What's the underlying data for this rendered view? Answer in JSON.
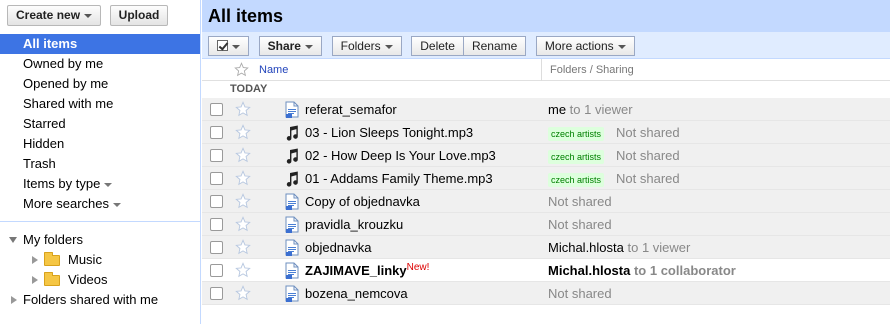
{
  "toolbar_left": {
    "create_new": "Create new",
    "upload": "Upload"
  },
  "nav": [
    {
      "label": "All items",
      "active": true
    },
    {
      "label": "Owned by me"
    },
    {
      "label": "Opened by me"
    },
    {
      "label": "Shared with me"
    },
    {
      "label": "Starred"
    },
    {
      "label": "Hidden"
    },
    {
      "label": "Trash"
    },
    {
      "label": "Items by type",
      "dropdown": true
    },
    {
      "label": "More searches",
      "dropdown": true
    }
  ],
  "tree": {
    "my_folders": "My folders",
    "music": "Music",
    "videos": "Videos",
    "shared_folders": "Folders shared with me"
  },
  "main": {
    "title": "All items",
    "buttons": {
      "folders": "Folders",
      "delete": "Delete",
      "rename": "Rename",
      "share": "Share",
      "more_actions": "More actions"
    },
    "columns": {
      "name": "Name",
      "sharing": "Folders / Sharing"
    },
    "section": "TODAY",
    "new_tag": "New!"
  },
  "files": [
    {
      "name": "referat_semafor",
      "type": "doc",
      "who": "me",
      "rest": " to 1 viewer"
    },
    {
      "name": "03 - Lion Sleeps Tonight.mp3",
      "type": "audio",
      "label": "czech artists",
      "rest": "Not shared"
    },
    {
      "name": "02 - How Deep Is Your Love.mp3",
      "type": "audio",
      "label": "czech artists",
      "rest": "Not shared"
    },
    {
      "name": "01 - Addams Family Theme.mp3",
      "type": "audio",
      "label": "czech artists",
      "rest": "Not shared"
    },
    {
      "name": "Copy of objednavka",
      "type": "doc",
      "rest": "Not shared"
    },
    {
      "name": "pravidla_krouzku",
      "type": "doc",
      "rest": "Not shared"
    },
    {
      "name": "objednavka",
      "type": "doc",
      "who": "Michal.hlosta",
      "rest": " to 1 viewer"
    },
    {
      "name": "ZAJIMAVE_linky",
      "type": "doc",
      "unread": true,
      "new": true,
      "who": "Michal.hlosta",
      "rest": " to 1 collaborator"
    },
    {
      "name": "bozena_nemcova",
      "type": "doc",
      "rest": "Not shared"
    }
  ],
  "colors": {
    "accent": "#3d74e4",
    "header": "#c3d9ff",
    "toolbar": "#e0ecff",
    "label_bg": "#ddffdd",
    "label_fg": "#008000"
  }
}
